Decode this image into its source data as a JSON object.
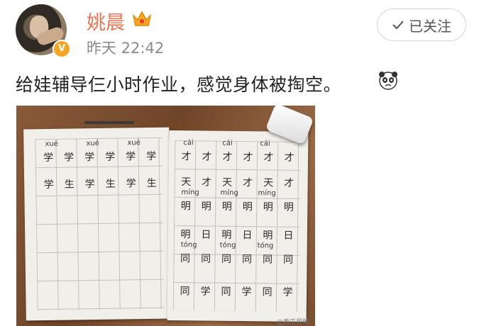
{
  "user": {
    "name": "姚晨",
    "verified_badge": "V",
    "badge_color": "#f5a623",
    "name_color": "#eb7350"
  },
  "post": {
    "time": "昨天 22:42",
    "text": "给娃辅导仨小时作业，感觉身体被掏空。",
    "emoji": "panda-face-emoji"
  },
  "follow_button": {
    "label": "已关注",
    "icon": "check-icon"
  },
  "photo": {
    "left_page": {
      "pinyin": [
        "xué",
        "xué",
        "xué"
      ],
      "row1": [
        "学",
        "学",
        "学",
        "学",
        "学",
        "学"
      ],
      "row2": [
        "学",
        "生",
        "学",
        "生",
        "学",
        "生"
      ]
    },
    "right_page": {
      "pinyin_cai": [
        "cái",
        "cái",
        "cái"
      ],
      "row1": [
        "才",
        "才",
        "才",
        "才",
        "才",
        "才"
      ],
      "row2": [
        "天",
        "才",
        "天",
        "才",
        "天",
        "才"
      ],
      "pinyin_ming": [
        "míng",
        "míng",
        "míng"
      ],
      "row3": [
        "明",
        "明",
        "明",
        "明",
        "明",
        "明"
      ],
      "row4": [
        "明",
        "日",
        "明",
        "日",
        "明",
        "日"
      ],
      "pinyin_tong": [
        "tóng",
        "tóng",
        "tóng"
      ],
      "row5": [
        "同",
        "同",
        "同",
        "同",
        "同",
        "同"
      ],
      "row6": [
        "同",
        "学",
        "同",
        "学",
        "同",
        "学"
      ]
    },
    "watermark": "@西瓜视频"
  }
}
